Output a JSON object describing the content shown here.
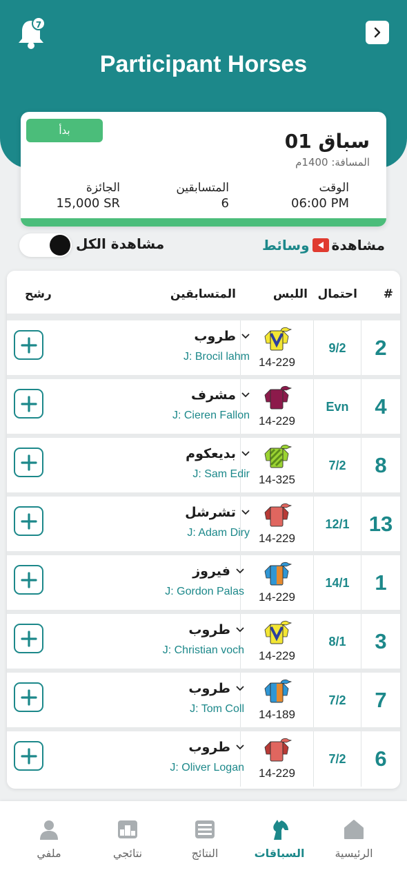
{
  "header": {
    "title": "Participant Horses",
    "notifications_count": "7"
  },
  "race": {
    "start_label": "بدأ",
    "name": "سباق 01",
    "distance": "المسافة: 1400م",
    "time_label": "الوقت",
    "time_value": "06:00 PM",
    "runners_label": "المتسابقين",
    "runners_value": "6",
    "prize_label": "الجائزة",
    "prize_value": "15,000 SR"
  },
  "controls": {
    "view_all_label": "مشاهدة الكل",
    "view_all_on": true,
    "media_label_1": "مشاهدة",
    "media_label_2": "وسائط"
  },
  "table": {
    "headers": {
      "num": "#",
      "odds": "احتمال",
      "silks": "اللبس",
      "runner": "المتسابقين",
      "nominate": "رشح"
    },
    "rows": [
      {
        "num": "2",
        "odds": "9/2",
        "silk_code": "14-229",
        "horse": "طروب",
        "jockey": "J: Brocil lahm",
        "silk": {
          "body": "#f3e634",
          "sleeve": "#f3e634",
          "pattern": "chevron",
          "accent": "#2d3f9e",
          "cap": "#f3e634"
        }
      },
      {
        "num": "4",
        "odds": "Evn",
        "silk_code": "14-229",
        "horse": "مشرف",
        "jockey": "J: Cieren Fallon",
        "silk": {
          "body": "#8c1a4b",
          "sleeve": "#8c1a4b",
          "pattern": "plain",
          "accent": "#c66a8f",
          "cap": "#8c1a4b"
        }
      },
      {
        "num": "8",
        "odds": "7/2",
        "silk_code": "14-325",
        "horse": "بديعكوم",
        "jockey": "J: Sam Edir",
        "silk": {
          "body": "#9bd332",
          "sleeve": "#9bd332",
          "pattern": "stripes",
          "accent": "#5c8d1c",
          "cap": "#9bd332"
        }
      },
      {
        "num": "13",
        "odds": "12/1",
        "silk_code": "14-229",
        "horse": "تشرشل",
        "jockey": "J: Adam Diry",
        "silk": {
          "body": "#e0665f",
          "sleeve": "#b83a36",
          "pattern": "plain",
          "accent": "#b83a36",
          "cap": "#e0665f"
        }
      },
      {
        "num": "1",
        "odds": "14/1",
        "silk_code": "14-229",
        "horse": "فيروز",
        "jockey": "J: Gordon Palas",
        "silk": {
          "body": "#2f96d4",
          "sleeve": "#2f96d4",
          "pattern": "halves",
          "accent": "#e68a2e",
          "cap": "#2f96d4"
        }
      },
      {
        "num": "3",
        "odds": "8/1",
        "silk_code": "14-229",
        "horse": "طروب",
        "jockey": "J: Christian voch",
        "silk": {
          "body": "#f3e634",
          "sleeve": "#f3e634",
          "pattern": "chevron",
          "accent": "#2d3f9e",
          "cap": "#f3e634"
        }
      },
      {
        "num": "7",
        "odds": "7/2",
        "silk_code": "14-189",
        "horse": "طروب",
        "jockey": "J: Tom Coll",
        "silk": {
          "body": "#2f96d4",
          "sleeve": "#2f96d4",
          "pattern": "halves",
          "accent": "#e68a2e",
          "cap": "#2f96d4"
        }
      },
      {
        "num": "6",
        "odds": "7/2",
        "silk_code": "14-229",
        "horse": "طروب",
        "jockey": "J: Oliver Logan",
        "silk": {
          "body": "#e0665f",
          "sleeve": "#b83a36",
          "pattern": "plain",
          "accent": "#b83a36",
          "cap": "#e0665f"
        }
      }
    ]
  },
  "nav": {
    "items": [
      {
        "label": "الرئيسية",
        "icon": "home-icon",
        "active": false
      },
      {
        "label": "السباقات",
        "icon": "horse-icon",
        "active": true
      },
      {
        "label": "النتائج",
        "icon": "results-list-icon",
        "active": false
      },
      {
        "label": "نتائجي",
        "icon": "podium-icon",
        "active": false
      },
      {
        "label": "ملفي",
        "icon": "profile-icon",
        "active": false
      }
    ]
  },
  "colors": {
    "brand_teal": "#1c888a",
    "status_green": "#4bbd7a",
    "media_red": "#e03b30"
  }
}
